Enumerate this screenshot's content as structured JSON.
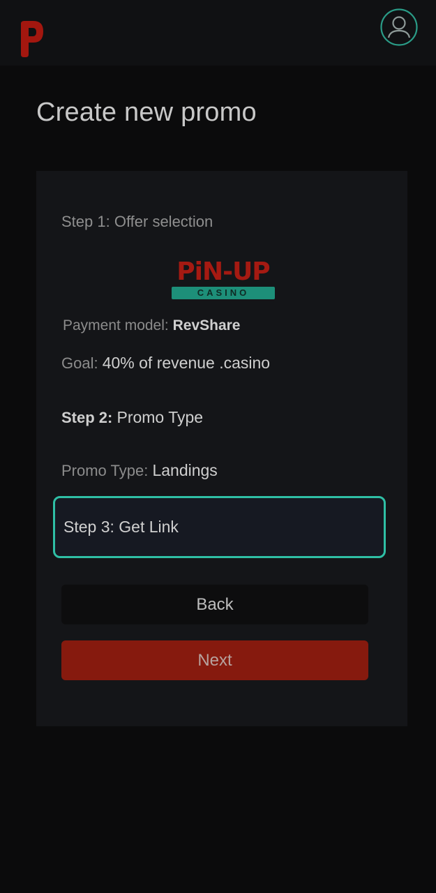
{
  "header": {
    "logo_icon": "p-brand-logo",
    "avatar_icon": "user-profile-icon",
    "accent_color": "#2fbfa5",
    "brand_color": "#a51a12"
  },
  "page": {
    "title": "Create new promo"
  },
  "steps": {
    "step1_label": "Step 1: Offer selection",
    "brand": {
      "word": "PiN-UP",
      "sub": "CASINO"
    },
    "payment_label": "Payment model:",
    "payment_value": "RevShare",
    "goal_label": "Goal:",
    "goal_value": "40% of revenue .casino",
    "step2_prefix": "Step 2:",
    "step2_label": "Promo Type",
    "promo_type_label": "Promo Type:",
    "promo_type_value": "Landings",
    "step3_label": "Step 3: Get Link"
  },
  "buttons": {
    "back_label": "Back",
    "next_label": "Next",
    "next_color": "#861a0e"
  }
}
